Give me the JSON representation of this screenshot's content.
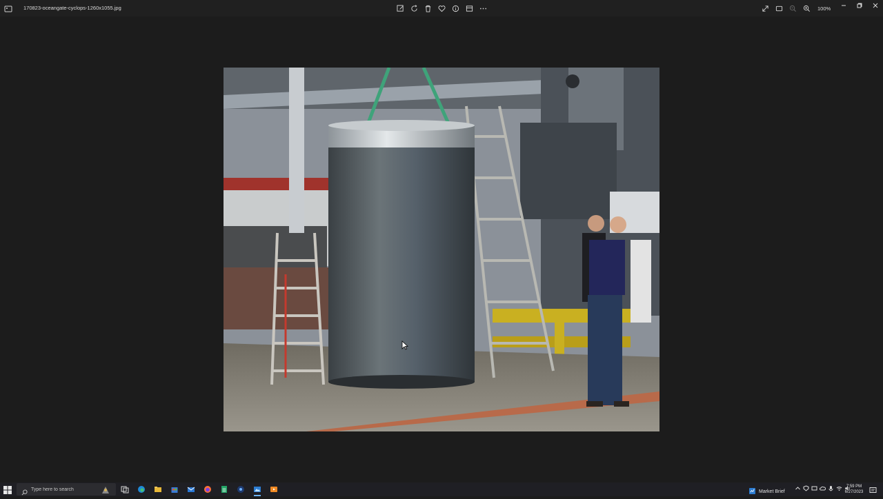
{
  "window": {
    "file_name": "170823-oceangate-cyclops-1260x1055.jpg",
    "zoom": "100%"
  },
  "toolbar": {
    "center_icons": [
      "edit-image-icon",
      "rotate-icon",
      "delete-icon",
      "favorite-icon",
      "info-icon",
      "edit-icon",
      "more-icon"
    ],
    "right_icons": [
      "expand-icon",
      "slideshow-icon",
      "zoom-out-icon",
      "zoom-in-icon"
    ]
  },
  "taskbar": {
    "search_placeholder": "Type here to search",
    "apps": [
      "task-view-icon",
      "edge-icon",
      "file-explorer-icon",
      "store-icon",
      "mail-icon",
      "firefox-icon",
      "sheets-icon",
      "app-icon",
      "photos-icon",
      "media-icon"
    ],
    "widget_label": "Market Brief",
    "time": "7:59 PM",
    "date": "6/27/2023"
  },
  "colors": {
    "background": "#1c1c1c",
    "taskbar": "#1f1f24",
    "accent": "#6db3f2"
  }
}
